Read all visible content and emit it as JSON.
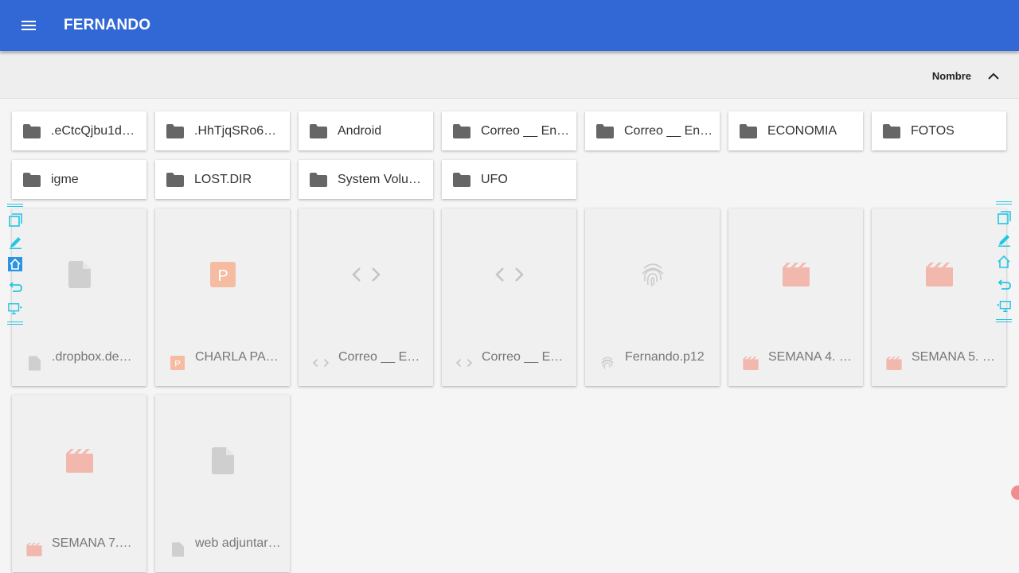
{
  "appbar": {
    "title": "FERNANDO"
  },
  "sortbar": {
    "label": "Nombre"
  },
  "folders": [
    ".eCtcQjbu1dg…",
    ".HhTjqSRo6d…",
    "Android",
    "Correo __ Ent…",
    "Correo __ Ent…",
    "ECONOMIA",
    "FOTOS",
    "igme",
    "LOST.DIR",
    "System Volu…",
    "UFO"
  ],
  "files": [
    {
      "name": ".dropbox.dev…",
      "icon": "document-icon"
    },
    {
      "name": "CHARLA PA…",
      "icon": "presentation-icon"
    },
    {
      "name": "Correo __ Ent…",
      "icon": "code-icon"
    },
    {
      "name": "Correo __ Ent…",
      "icon": "code-icon"
    },
    {
      "name": "Fernando.p12",
      "icon": "fingerprint-icon"
    },
    {
      "name": "SEMANA 4. 1…",
      "icon": "video-icon"
    },
    {
      "name": "SEMANA 5. 1…",
      "icon": "video-icon"
    },
    {
      "name": "SEMANA 7.…",
      "icon": "video-icon"
    },
    {
      "name": "web adjuntar…",
      "icon": "document-icon"
    }
  ],
  "colors": {
    "appbar": "#3267d6",
    "folder_icon": "#666666",
    "file_icon_gray": "#cfcfcf",
    "media_icon": "#f2b8ae",
    "toolbar": "#22c6e6"
  }
}
